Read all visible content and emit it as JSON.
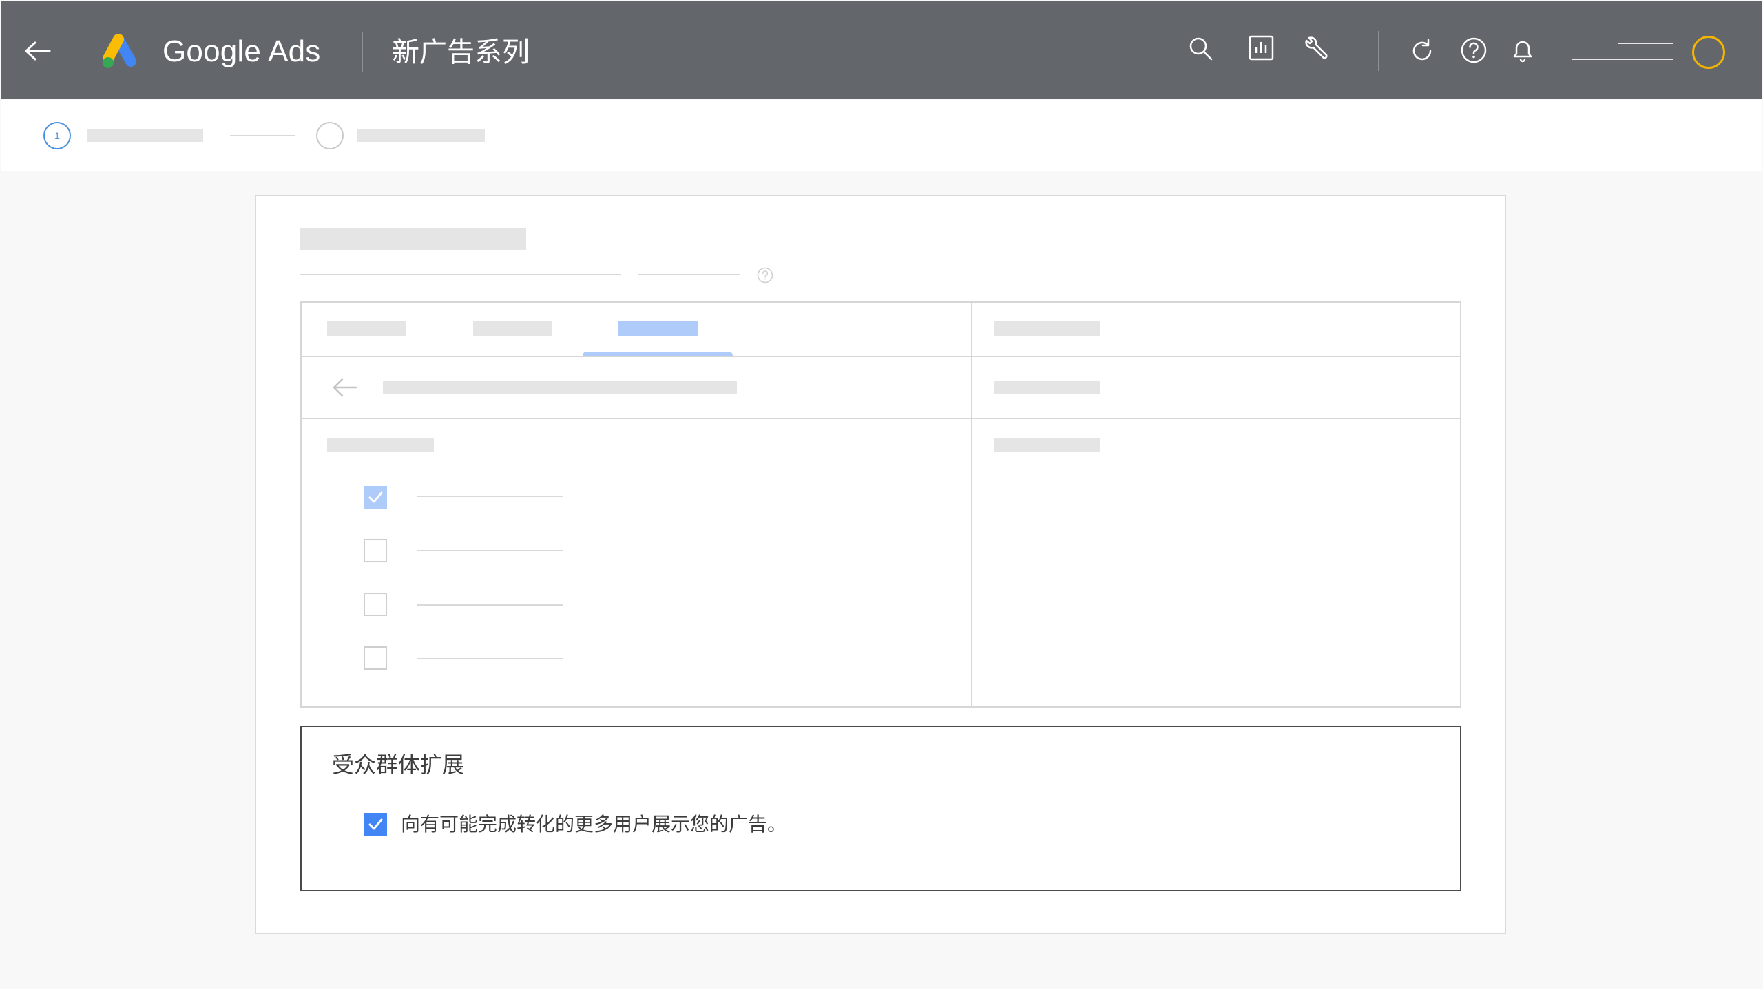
{
  "topbar": {
    "brand": "Google Ads",
    "page_title": "新广告系列",
    "background_color": "#63666a",
    "icons": [
      "back-arrow-icon",
      "search-icon",
      "reports-icon",
      "tools-wrench-icon",
      "refresh-icon",
      "help-icon",
      "notifications-bell-icon"
    ],
    "avatar_ring_color": "#f4b400"
  },
  "stepper": {
    "step1_number": "1",
    "step1_color": "#4a90e2"
  },
  "tabs": {
    "active_tab_color": "#aecbfa"
  },
  "options": [
    {
      "checked": true
    },
    {
      "checked": false
    },
    {
      "checked": false
    },
    {
      "checked": false
    }
  ],
  "audience_expansion": {
    "title": "受众群体扩展",
    "checkbox_label": "向有可能完成转化的更多用户展示您的广告。",
    "checked": true,
    "checkbox_color": "#4285f4"
  }
}
